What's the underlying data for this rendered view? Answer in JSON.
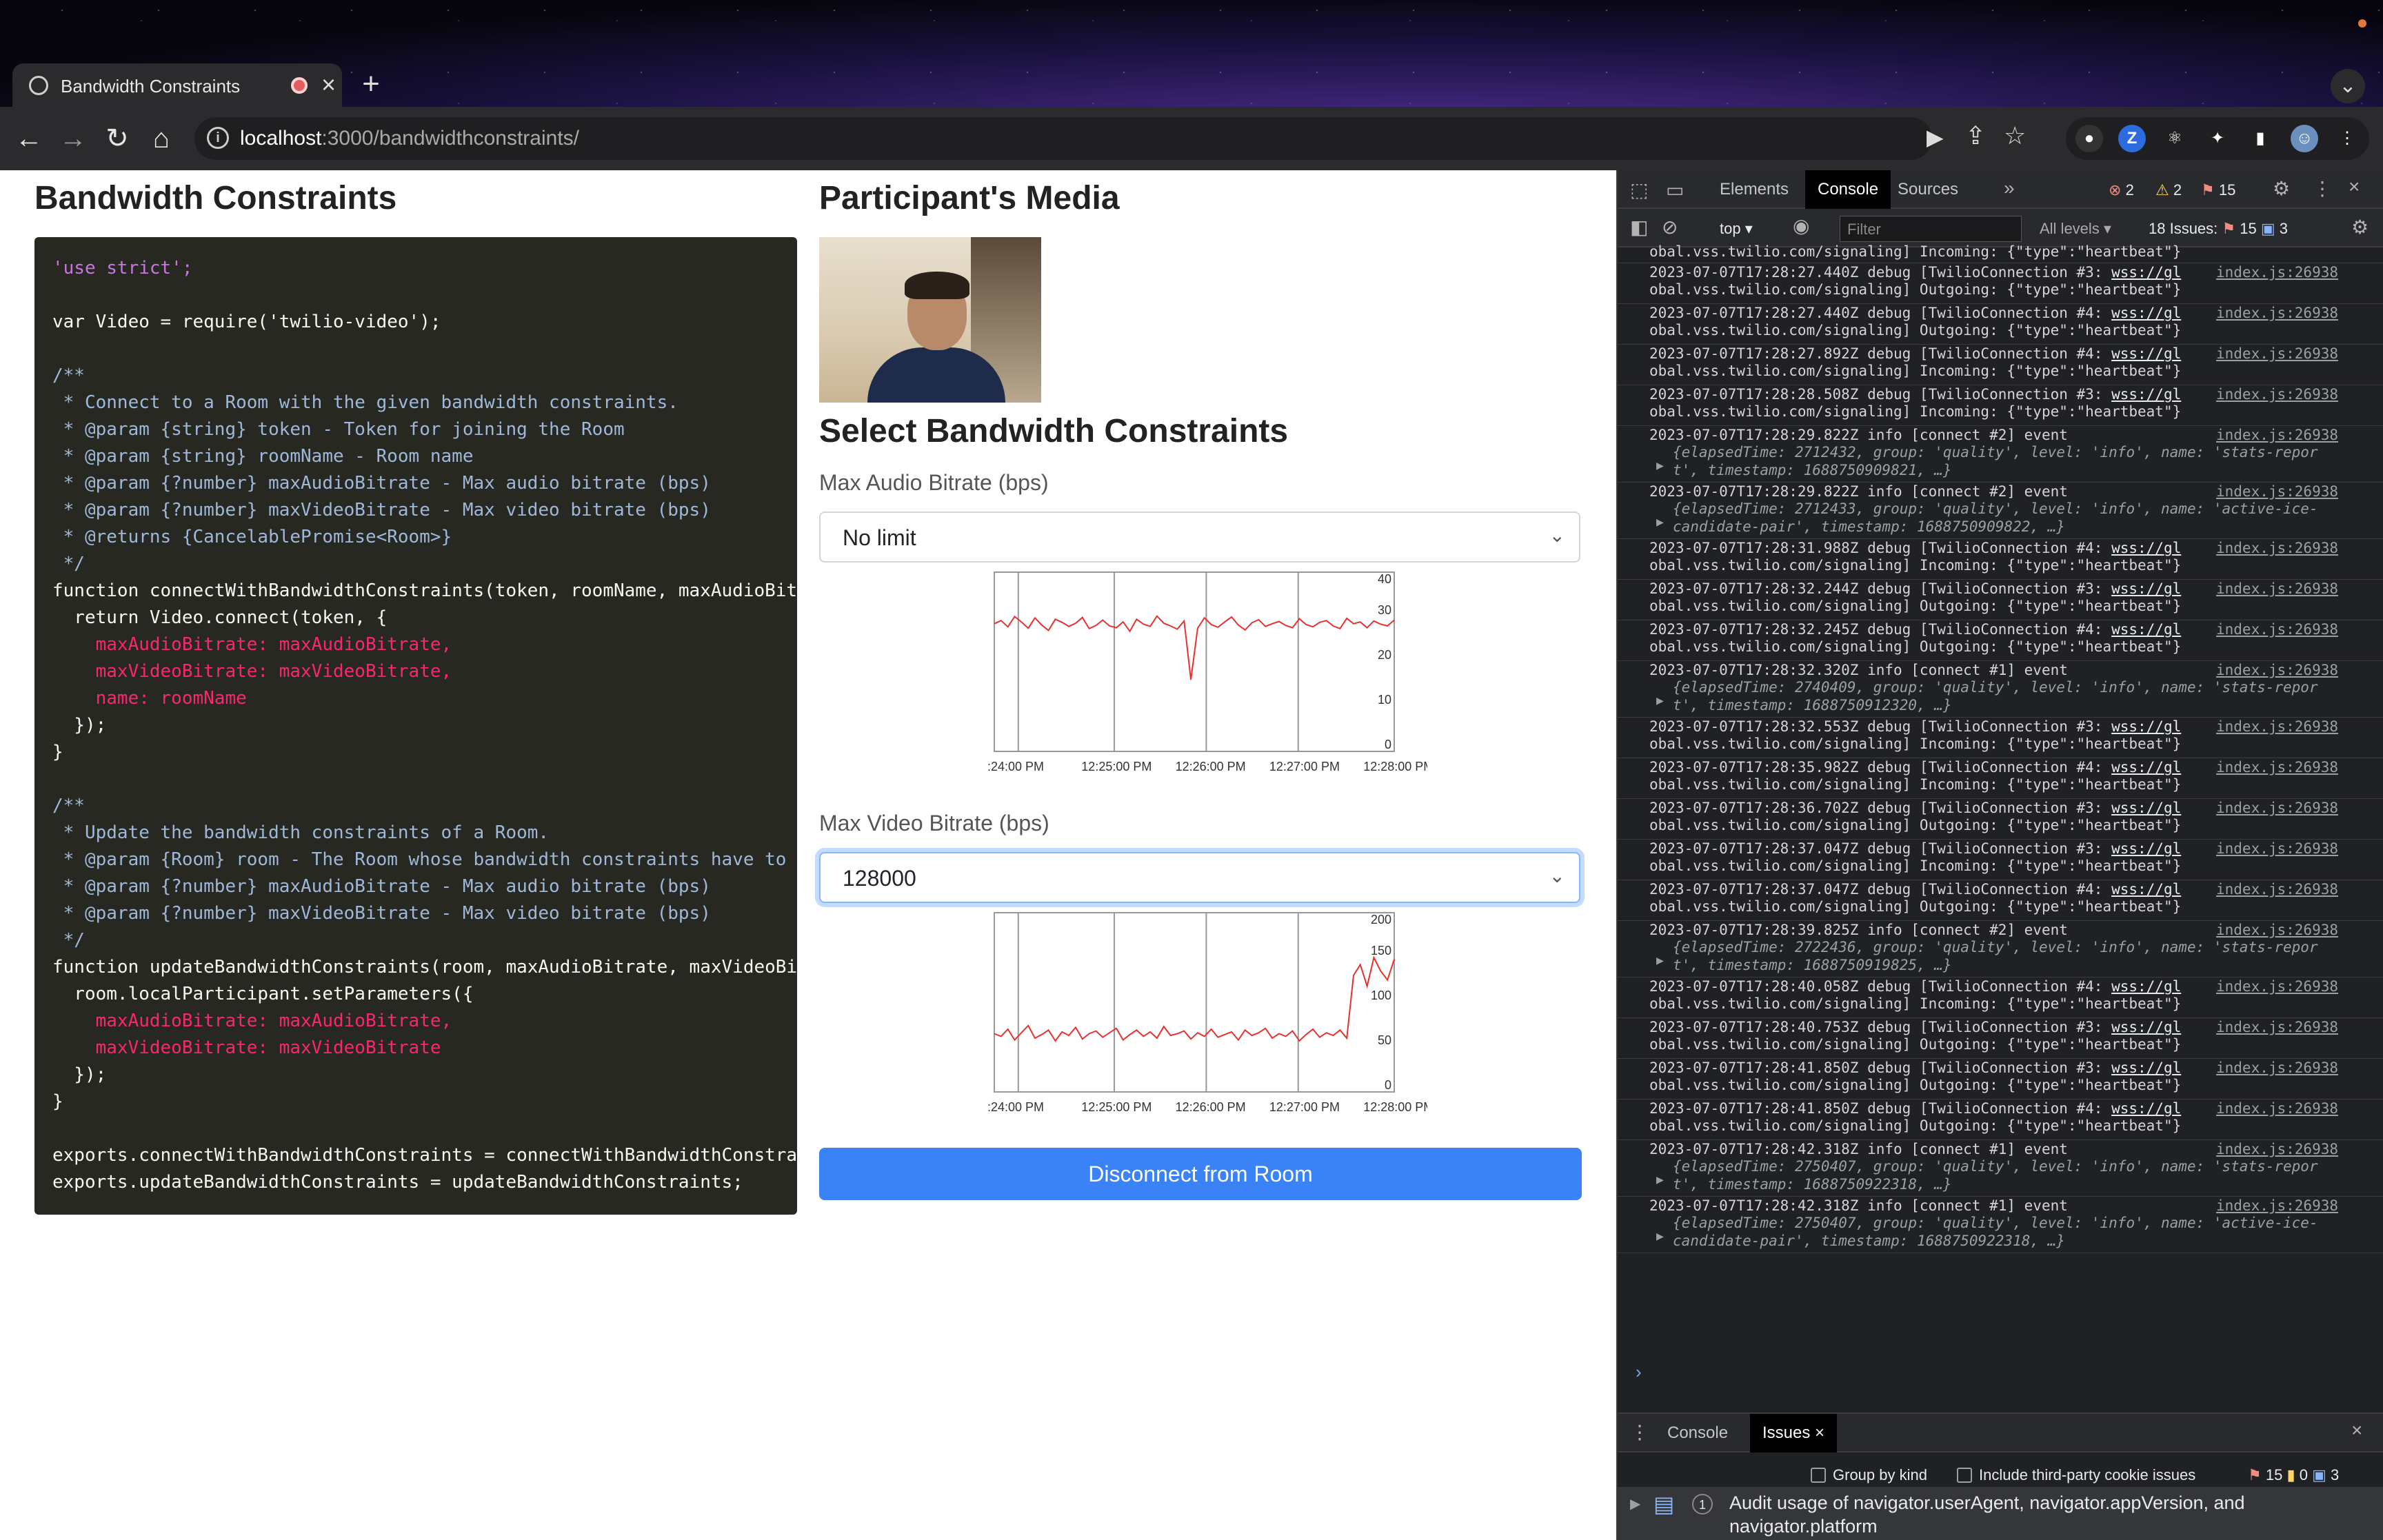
{
  "browser": {
    "tab_title": "Bandwidth Constraints",
    "url_host": "localhost",
    "url_path": ":3000/bandwidthconstraints/"
  },
  "page": {
    "left_title": "Bandwidth Constraints",
    "media_title": "Participant's Media",
    "select_title": "Select Bandwidth Constraints",
    "audio_label": "Max Audio Bitrate (bps)",
    "audio_value": "No limit",
    "video_label": "Max Video Bitrate (bps)",
    "video_value": "128000",
    "disconnect_label": "Disconnect from Room",
    "code_lines": [
      "'use strict';",
      "",
      "var Video = require('twilio-video');",
      "",
      "/**",
      " * Connect to a Room with the given bandwidth constraints.",
      " * @param {string} token - Token for joining the Room",
      " * @param {string} roomName - Room name",
      " * @param {?number} maxAudioBitrate - Max audio bitrate (bps)",
      " * @param {?number} maxVideoBitrate - Max video bitrate (bps)",
      " * @returns {CancelablePromise<Room>}",
      " */",
      "function connectWithBandwidthConstraints(token, roomName, maxAudioBit",
      "  return Video.connect(token, {",
      "    maxAudioBitrate: maxAudioBitrate,",
      "    maxVideoBitrate: maxVideoBitrate,",
      "    name: roomName",
      "  });",
      "}",
      "",
      "/**",
      " * Update the bandwidth constraints of a Room.",
      " * @param {Room} room - The Room whose bandwidth constraints have to b",
      " * @param {?number} maxAudioBitrate - Max audio bitrate (bps)",
      " * @param {?number} maxVideoBitrate - Max video bitrate (bps)",
      " */",
      "function updateBandwidthConstraints(room, maxAudioBitrate, maxVideoBit",
      "  room.localParticipant.setParameters({",
      "    maxAudioBitrate: maxAudioBitrate,",
      "    maxVideoBitrate: maxVideoBitrate",
      "  });",
      "}",
      "",
      "exports.connectWithBandwidthConstraints = connectWithBandwidthConstrai",
      "exports.updateBandwidthConstraints = updateBandwidthConstraints;"
    ]
  },
  "chart_data": [
    {
      "type": "line",
      "title": "",
      "x_ticks": [
        ":24:00 PM",
        "12:25:00 PM",
        "12:26:00 PM",
        "12:27:00 PM",
        "12:28:00 PM"
      ],
      "y_ticks": [
        0,
        10,
        20,
        30,
        40
      ],
      "ylim": [
        0,
        40
      ],
      "series": [
        {
          "color": "#e8312f",
          "values": [
            28.5,
            29.2,
            27.8,
            30.1,
            28.9,
            27.5,
            29.8,
            28.2,
            27.0,
            29.5,
            28.8,
            27.9,
            28.6,
            29.9,
            27.4,
            28.1,
            29.3,
            28.0,
            27.6,
            28.9,
            26.8,
            29.5,
            28.4,
            27.9,
            30.2,
            28.6,
            28.0,
            27.3,
            29.1,
            16.0,
            27.5,
            29.8,
            28.3,
            27.7,
            28.9,
            30.0,
            28.2,
            27.1,
            28.7,
            29.4,
            27.9,
            28.5,
            29.0,
            28.1,
            27.6,
            29.6,
            28.3,
            27.8,
            28.8,
            29.2,
            28.0,
            27.4,
            29.7,
            28.5,
            28.9,
            27.6,
            29.1,
            28.4,
            28.0,
            29.3
          ]
        }
      ]
    },
    {
      "type": "line",
      "title": "",
      "x_ticks": [
        ":24:00 PM",
        "12:25:00 PM",
        "12:26:00 PM",
        "12:27:00 PM",
        "12:28:00 PM"
      ],
      "y_ticks": [
        0,
        50,
        100,
        150,
        200
      ],
      "ylim": [
        0,
        200
      ],
      "series": [
        {
          "color": "#e8312f",
          "values": [
            65,
            62,
            70,
            58,
            66,
            74,
            60,
            64,
            69,
            57,
            67,
            63,
            72,
            59,
            65,
            68,
            61,
            66,
            71,
            58,
            64,
            69,
            62,
            67,
            60,
            73,
            63,
            65,
            68,
            59,
            66,
            62,
            70,
            61,
            64,
            67,
            58,
            69,
            63,
            66,
            71,
            60,
            65,
            62,
            68,
            57,
            64,
            70,
            61,
            66,
            63,
            69,
            60,
            130,
            142,
            118,
            150,
            135,
            125,
            148
          ]
        }
      ]
    }
  ],
  "devtools": {
    "tabs": [
      "Elements",
      "Console",
      "Sources"
    ],
    "errors": "2",
    "warnings": "2",
    "issues_count": "15",
    "context": "top",
    "filter_placeholder": "Filter",
    "levels": "All levels",
    "issues_label": "18 Issues:",
    "issues_red": "15",
    "issues_blue": "3",
    "drawer_tabs": [
      "Console",
      "Issues"
    ],
    "group_by_kind": "Group by kind",
    "third_party": "Include third-party cookie issues",
    "drawer_red": "15",
    "drawer_yellow": "0",
    "drawer_blue": "3",
    "issue_count": "1",
    "issue_text_1": "Audit usage of navigator.userAgent, navigator.appVersion, and",
    "issue_text_2": "navigator.platform",
    "source": "index.js:26938",
    "log_top_partial": "obal.vss.twilio.com/signaling] Incoming: {\"type\":\"heartbeat\"}",
    "logs": [
      {
        "kind": "debug",
        "l1": "2023-07-07T17:28:27.440Z debug [TwilioConnection #3: ",
        "wss": "wss://gl",
        "l2": "obal.vss.twilio.com/signaling] Outgoing: {\"type\":\"heartbeat\"}"
      },
      {
        "kind": "debug",
        "l1": "2023-07-07T17:28:27.440Z debug [TwilioConnection #4: ",
        "wss": "wss://gl",
        "l2": "obal.vss.twilio.com/signaling] Outgoing: {\"type\":\"heartbeat\"}"
      },
      {
        "kind": "debug",
        "l1": "2023-07-07T17:28:27.892Z debug [TwilioConnection #4: ",
        "wss": "wss://gl",
        "l2": "obal.vss.twilio.com/signaling] Incoming: {\"type\":\"heartbeat\"}"
      },
      {
        "kind": "debug",
        "l1": "2023-07-07T17:28:28.508Z debug [TwilioConnection #3: ",
        "wss": "wss://gl",
        "l2": "obal.vss.twilio.com/signaling] Incoming: {\"type\":\"heartbeat\"}"
      },
      {
        "kind": "info",
        "l1": "2023-07-07T17:28:29.822Z info [connect #2] event",
        "l2": "{elapsedTime: 2712432, group: 'quality', level: 'info', name: 'stats-repor",
        "l3": "t', timestamp: 1688750909821, …}"
      },
      {
        "kind": "info",
        "l1": "2023-07-07T17:28:29.822Z info [connect #2] event",
        "l2": "{elapsedTime: 2712433, group: 'quality', level: 'info', name: 'active-ice-",
        "l3": "candidate-pair', timestamp: 1688750909822, …}"
      },
      {
        "kind": "debug",
        "l1": "2023-07-07T17:28:31.988Z debug [TwilioConnection #4: ",
        "wss": "wss://gl",
        "l2": "obal.vss.twilio.com/signaling] Incoming: {\"type\":\"heartbeat\"}"
      },
      {
        "kind": "debug",
        "l1": "2023-07-07T17:28:32.244Z debug [TwilioConnection #3: ",
        "wss": "wss://gl",
        "l2": "obal.vss.twilio.com/signaling] Outgoing: {\"type\":\"heartbeat\"}"
      },
      {
        "kind": "debug",
        "l1": "2023-07-07T17:28:32.245Z debug [TwilioConnection #4: ",
        "wss": "wss://gl",
        "l2": "obal.vss.twilio.com/signaling] Outgoing: {\"type\":\"heartbeat\"}"
      },
      {
        "kind": "info",
        "l1": "2023-07-07T17:28:32.320Z info [connect #1] event",
        "l2": "{elapsedTime: 2740409, group: 'quality', level: 'info', name: 'stats-repor",
        "l3": "t', timestamp: 1688750912320, …}"
      },
      {
        "kind": "debug",
        "l1": "2023-07-07T17:28:32.553Z debug [TwilioConnection #3: ",
        "wss": "wss://gl",
        "l2": "obal.vss.twilio.com/signaling] Incoming: {\"type\":\"heartbeat\"}"
      },
      {
        "kind": "debug",
        "l1": "2023-07-07T17:28:35.982Z debug [TwilioConnection #4: ",
        "wss": "wss://gl",
        "l2": "obal.vss.twilio.com/signaling] Incoming: {\"type\":\"heartbeat\"}"
      },
      {
        "kind": "debug",
        "l1": "2023-07-07T17:28:36.702Z debug [TwilioConnection #3: ",
        "wss": "wss://gl",
        "l2": "obal.vss.twilio.com/signaling] Outgoing: {\"type\":\"heartbeat\"}"
      },
      {
        "kind": "debug",
        "l1": "2023-07-07T17:28:37.047Z debug [TwilioConnection #3: ",
        "wss": "wss://gl",
        "l2": "obal.vss.twilio.com/signaling] Incoming: {\"type\":\"heartbeat\"}"
      },
      {
        "kind": "debug",
        "l1": "2023-07-07T17:28:37.047Z debug [TwilioConnection #4: ",
        "wss": "wss://gl",
        "l2": "obal.vss.twilio.com/signaling] Outgoing: {\"type\":\"heartbeat\"}"
      },
      {
        "kind": "info",
        "l1": "2023-07-07T17:28:39.825Z info [connect #2] event",
        "l2": "{elapsedTime: 2722436, group: 'quality', level: 'info', name: 'stats-repor",
        "l3": "t', timestamp: 1688750919825, …}"
      },
      {
        "kind": "debug",
        "l1": "2023-07-07T17:28:40.058Z debug [TwilioConnection #4: ",
        "wss": "wss://gl",
        "l2": "obal.vss.twilio.com/signaling] Incoming: {\"type\":\"heartbeat\"}"
      },
      {
        "kind": "debug",
        "l1": "2023-07-07T17:28:40.753Z debug [TwilioConnection #3: ",
        "wss": "wss://gl",
        "l2": "obal.vss.twilio.com/signaling] Outgoing: {\"type\":\"heartbeat\"}"
      },
      {
        "kind": "debug",
        "l1": "2023-07-07T17:28:41.850Z debug [TwilioConnection #3: ",
        "wss": "wss://gl",
        "l2": "obal.vss.twilio.com/signaling] Outgoing: {\"type\":\"heartbeat\"}"
      },
      {
        "kind": "debug",
        "l1": "2023-07-07T17:28:41.850Z debug [TwilioConnection #4: ",
        "wss": "wss://gl",
        "l2": "obal.vss.twilio.com/signaling] Outgoing: {\"type\":\"heartbeat\"}"
      },
      {
        "kind": "info",
        "l1": "2023-07-07T17:28:42.318Z info [connect #1] event",
        "l2": "{elapsedTime: 2750407, group: 'quality', level: 'info', name: 'stats-repor",
        "l3": "t', timestamp: 1688750922318, …}"
      },
      {
        "kind": "info",
        "l1": "2023-07-07T17:28:42.318Z info [connect #1] event",
        "l2": "{elapsedTime: 2750407, group: 'quality', level: 'info', name: 'active-ice-",
        "l3": "candidate-pair', timestamp: 1688750922318, …}"
      }
    ]
  }
}
